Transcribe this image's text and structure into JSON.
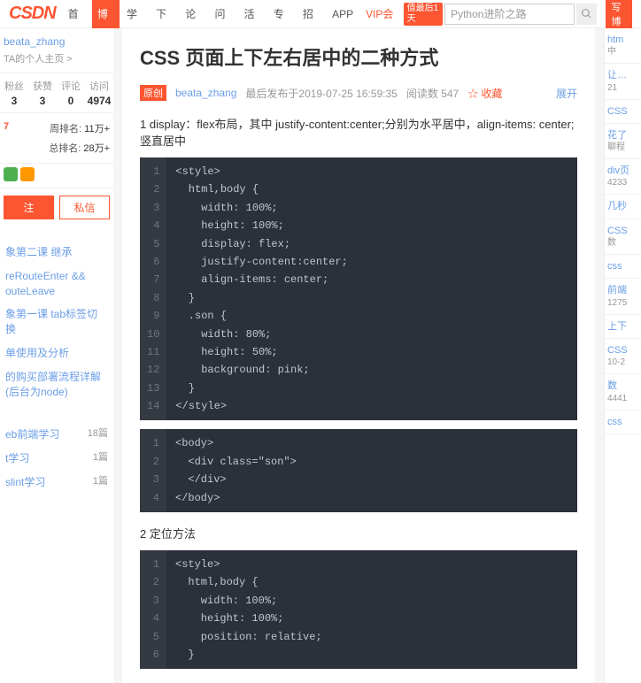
{
  "nav": {
    "logo": "CSDN",
    "items": [
      "首页",
      "博客",
      "学院",
      "下载",
      "论坛",
      "问答",
      "活动",
      "专题",
      "招聘",
      "APP"
    ],
    "vip": "VIP会员",
    "badge": "值最后1天",
    "search_placeholder": "Python进阶之路",
    "right_action": "写博"
  },
  "profile": {
    "username": "beata_zhang",
    "home_link": "TA的个人主页 >",
    "stats": [
      {
        "label": "粉丝",
        "value": "3"
      },
      {
        "label": "获赞",
        "value": "3"
      },
      {
        "label": "评论",
        "value": "0"
      },
      {
        "label": "访问",
        "value": "4974"
      }
    ],
    "ranks": [
      {
        "label": "周排名:",
        "value": "11万+"
      },
      {
        "label": "总排名:",
        "value": "28万+"
      }
    ],
    "btn_follow": "注",
    "btn_msg": "私信"
  },
  "side_links1": [
    "象第二课 继承",
    "reRouteEnter && outeLeave",
    "象第一课 tab标签切换",
    "单使用及分析",
    "的购买部署流程详解(后台为node)"
  ],
  "side_links2": [
    {
      "text": "eb前端学习",
      "count": "18篇"
    },
    {
      "text": "t学习",
      "count": "1篇"
    },
    {
      "text": "slint学习",
      "count": "1篇"
    }
  ],
  "article": {
    "title": "CSS 页面上下左右居中的二种方式",
    "orig": "原创",
    "author": "beata_zhang",
    "date": "最后发布于2019-07-25 16:59:35",
    "reads": "阅读数 547",
    "fav": "收藏",
    "expand": "展开",
    "section1": "1 display：flex布局，其中 justify-content:center;分别为水平居中，align-items: center;竖直居中",
    "section2": "2 定位方法"
  },
  "code1": {
    "lines": [
      "<style>",
      "  html,body {",
      "    width: 100%;",
      "    height: 100%;",
      "    display: flex;",
      "    justify-content:center;",
      "    align-items: center;",
      "  }",
      "  .son {",
      "    width: 80%;",
      "    height: 50%;",
      "    background: pink;",
      "  }",
      "</style>"
    ]
  },
  "code2": {
    "lines": [
      "<body>",
      "  <div class=\"son\">",
      "  </div>",
      "</body>"
    ]
  },
  "code3": {
    "lines": [
      "<style>",
      "  html,body {",
      "    width: 100%;",
      "    height: 100%;",
      "    position: relative;",
      "  }"
    ]
  },
  "right_side": [
    {
      "t": "htm",
      "s": "中"
    },
    {
      "t": "让…",
      "s": "21"
    },
    {
      "t": "CSS",
      "s": ""
    },
    {
      "t": "花了",
      "s": "聊程"
    },
    {
      "t": "div页",
      "s": "4233"
    },
    {
      "t": "几秒",
      "s": ""
    },
    {
      "t": "CSS",
      "s": "数"
    },
    {
      "t": "css",
      "s": ""
    },
    {
      "t": "前端",
      "s": "1275"
    },
    {
      "t": "上下",
      "s": ""
    },
    {
      "t": "CSS",
      "s": "10-2"
    },
    {
      "t": "数",
      "s": "4441"
    },
    {
      "t": "css",
      "s": ""
    }
  ]
}
